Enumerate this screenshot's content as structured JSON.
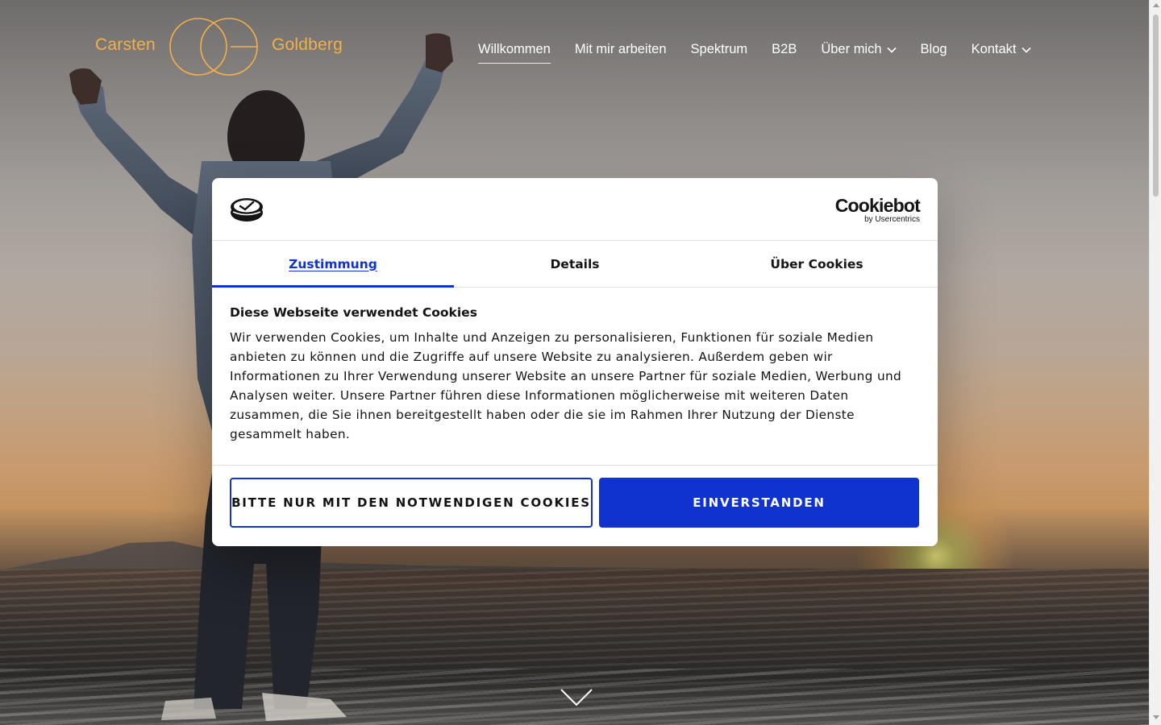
{
  "logo": {
    "first_name": "Carsten",
    "last_name": "Goldberg",
    "brand_color": "#f0b04a"
  },
  "nav": {
    "items": [
      {
        "label": "Willkommen",
        "active": true,
        "has_dropdown": false
      },
      {
        "label": "Mit mir arbeiten",
        "active": false,
        "has_dropdown": false
      },
      {
        "label": "Spektrum",
        "active": false,
        "has_dropdown": false
      },
      {
        "label": "B2B",
        "active": false,
        "has_dropdown": false
      },
      {
        "label": "Über mich",
        "active": false,
        "has_dropdown": true
      },
      {
        "label": "Blog",
        "active": false,
        "has_dropdown": false
      },
      {
        "label": "Kontakt",
        "active": false,
        "has_dropdown": true
      }
    ]
  },
  "cookie_dialog": {
    "brand": {
      "name": "Cookiebot",
      "byline": "by Usercentrics"
    },
    "tabs": [
      {
        "label": "Zustimmung",
        "active": true
      },
      {
        "label": "Details",
        "active": false
      },
      {
        "label": "Über Cookies",
        "active": false
      }
    ],
    "title": "Diese Webseite verwendet Cookies",
    "body": "Wir verwenden Cookies, um Inhalte und Anzeigen zu personalisieren, Funktionen für soziale Medien anbieten zu können und die Zugriffe auf unsere Website zu analysieren. Außerdem geben wir Informationen zu Ihrer Verwendung unserer Website an unsere Partner für soziale Medien, Werbung und Analysen weiter. Unsere Partner führen diese Informationen möglicherweise mit weiteren Daten zusammen, die Sie ihnen bereitgestellt haben oder die sie im Rahmen Ihrer Nutzung der Dienste gesammelt haben.",
    "buttons": {
      "necessary_only": "BITTE NUR MIT DEN NOTWENDIGEN COOKIES",
      "accept": "EINVERSTANDEN"
    },
    "accent_color": "#1032cf"
  },
  "icons": {
    "scroll_down": "chevron-down-icon",
    "dropdown": "chevron-down-icon",
    "cookiebot_mark": "cookiebot-icon"
  }
}
